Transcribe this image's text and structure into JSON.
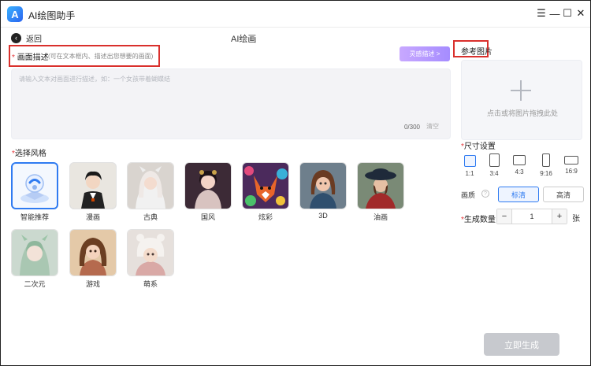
{
  "app": {
    "title": "AI绘图助手",
    "logo_letter": "A"
  },
  "window_controls": [
    "menu-icon",
    "minimize-icon",
    "maximize-icon",
    "close-icon"
  ],
  "header": {
    "back_label": "返回",
    "page_title": "AI绘画"
  },
  "description": {
    "required_mark": "*",
    "label": "画面描述",
    "hint": "(可在文本框内、描述出您想要的画面)",
    "inspire_button": "灵感描述 >",
    "placeholder": "请输入文本对画面进行描述，如：一个女孩带着蝴蝶结",
    "counter": "0/300",
    "clear": "清空"
  },
  "style": {
    "required_mark": "*",
    "label": "选择风格",
    "items": [
      {
        "name": "智能推荐",
        "selected": true
      },
      {
        "name": "漫画",
        "selected": false
      },
      {
        "name": "古典",
        "selected": false
      },
      {
        "name": "国风",
        "selected": false
      },
      {
        "name": "炫彩",
        "selected": false
      },
      {
        "name": "3D",
        "selected": false
      },
      {
        "name": "油画",
        "selected": false
      },
      {
        "name": "二次元",
        "selected": false
      },
      {
        "name": "游戏",
        "selected": false
      },
      {
        "name": "萌系",
        "selected": false
      }
    ]
  },
  "reference": {
    "label": "参考图片",
    "upload_text": "点击或将图片拖拽此处"
  },
  "size": {
    "required_mark": "*",
    "label": "尺寸设置",
    "options": [
      {
        "ratio": "1:1",
        "selected": true
      },
      {
        "ratio": "3:4",
        "selected": false
      },
      {
        "ratio": "4:3",
        "selected": false
      },
      {
        "ratio": "9:16",
        "selected": false
      },
      {
        "ratio": "16:9",
        "selected": false
      }
    ]
  },
  "quality": {
    "label": "画质",
    "options": [
      "标清",
      "高清"
    ],
    "selected": "标清"
  },
  "count": {
    "required_mark": "*",
    "label": "生成数量",
    "value": "1",
    "minus": "−",
    "plus": "+",
    "unit": "张"
  },
  "generate_button": "立即生成",
  "colors": {
    "accent": "#2f7bf1",
    "highlight_box": "#d9302c",
    "inspire": "#b197ff",
    "generate_disabled": "#c7c9ce"
  }
}
